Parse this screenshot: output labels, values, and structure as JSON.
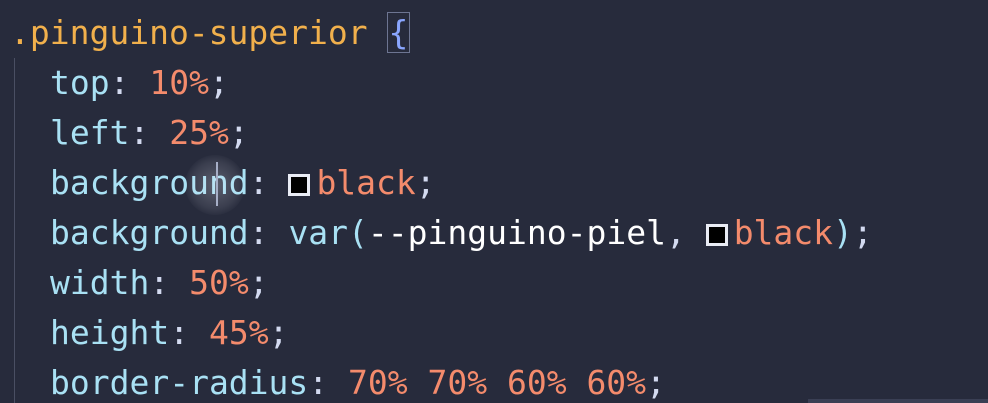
{
  "code": {
    "selector": ".pinguino-superior",
    "open_brace": "{",
    "lines": [
      {
        "prop": "top",
        "value": "10%"
      },
      {
        "prop": "left",
        "value": "25%"
      },
      {
        "prop": "background",
        "value": "black"
      },
      {
        "prop": "background",
        "fn": "var(",
        "var_name": "--pinguino-piel",
        "sep": ", ",
        "value": "black",
        "close": ")"
      },
      {
        "prop": "width",
        "value": "50%"
      },
      {
        "prop": "height",
        "value": "45%"
      },
      {
        "prop": "border-radius",
        "value": "70% 70% 60% 60%"
      }
    ],
    "colon": ":",
    "semicolon": ";",
    "swatch_color": "#000000"
  }
}
